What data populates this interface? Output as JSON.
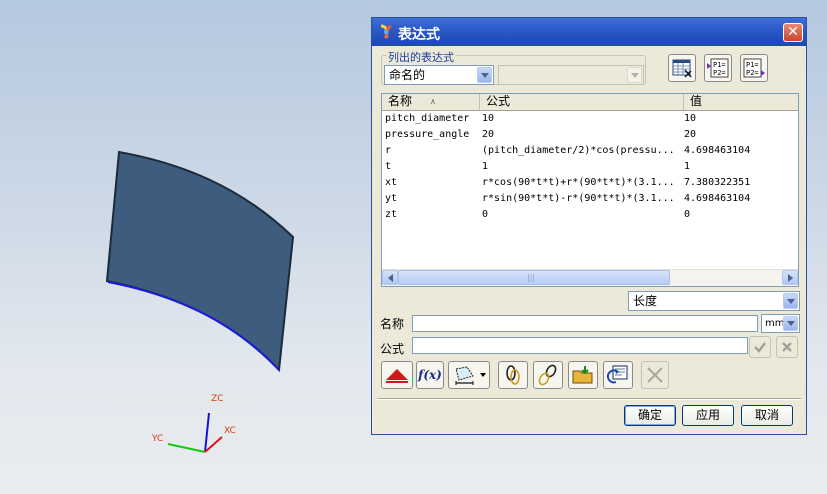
{
  "viewport": {
    "axes": {
      "zc": "ZC",
      "yc": "YC",
      "xc": "XC"
    },
    "colors": {
      "surface": "#3e5c7e",
      "edge": "#1a1ae0",
      "outline": "#1c2a3a"
    }
  },
  "dialog": {
    "title": "表达式",
    "close_icon": "close-icon",
    "list_group_label": "列出的表达式",
    "list_filter": {
      "selected": "命名的"
    },
    "secondary_filter": {
      "selected": ""
    },
    "table": {
      "columns": [
        "名称",
        "公式",
        "值"
      ],
      "sort_indicator": "∧",
      "rows": [
        {
          "name": "pitch_diameter",
          "formula": "10",
          "value": "10"
        },
        {
          "name": "pressure_angle",
          "formula": "20",
          "value": "20"
        },
        {
          "name": "r",
          "formula": "(pitch_diameter/2)*cos(pressu...",
          "value": "4.698463104"
        },
        {
          "name": "t",
          "formula": "1",
          "value": "1"
        },
        {
          "name": "xt",
          "formula": "r*cos(90*t*t)+r*(90*t*t)*(3.1...",
          "value": "7.380322351"
        },
        {
          "name": "yt",
          "formula": "r*sin(90*t*t)-r*(90*t*t)*(3.1...",
          "value": "4.698463104"
        },
        {
          "name": "zt",
          "formula": "0",
          "value": "0"
        }
      ],
      "scroll_grip": "|||"
    },
    "type_select": {
      "selected": "长度"
    },
    "name_label": "名称",
    "name_value": "",
    "unit_select": {
      "selected": "mm"
    },
    "formula_label": "公式",
    "formula_value": "",
    "buttons": {
      "ok": "确定",
      "apply": "应用",
      "cancel": "取消"
    },
    "icons": {
      "spreadsheet": "spreadsheet-icon",
      "list_p1p2": "list-parts-icon",
      "list_p1p2_arrow": "list-parts-arrow-icon",
      "collapse": "collapse-up-icon",
      "function": "function-icon",
      "measure": "measure-icon",
      "link": "link-expression-icon",
      "link_break": "break-link-icon",
      "import": "import-folder-icon",
      "export": "export-icon",
      "delete": "delete-icon",
      "accept": "checkmark-icon",
      "reject": "x-icon"
    },
    "fx_label": "f(x)",
    "p1_label": "P1=",
    "p2_label": "P2="
  }
}
